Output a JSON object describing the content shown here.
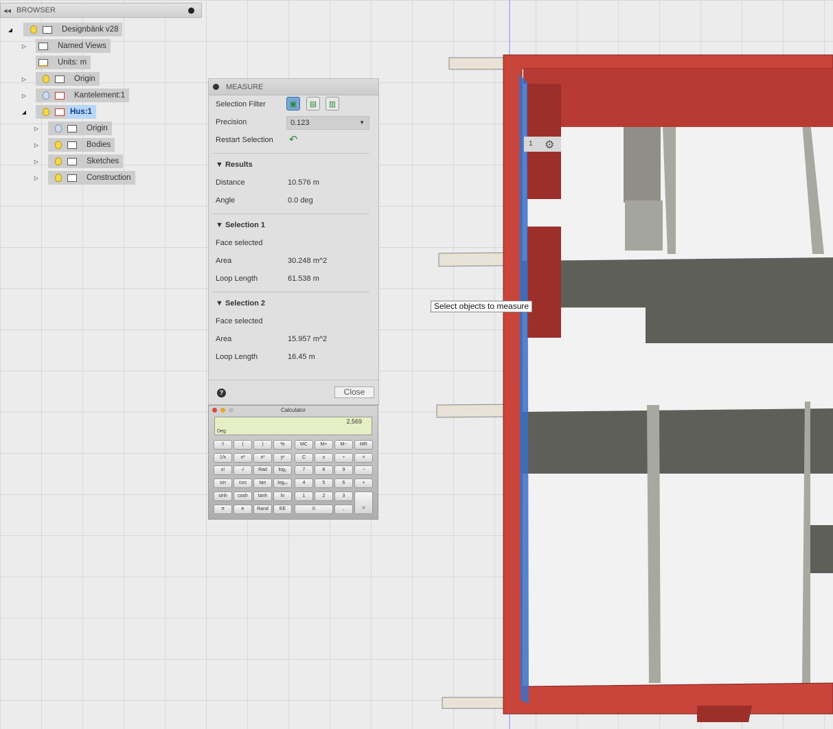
{
  "browser": {
    "title": "BROWSER",
    "nodes": [
      {
        "label": "Designbänk v28",
        "expanded": true
      },
      {
        "label": "Named Views"
      },
      {
        "label": "Units: m"
      },
      {
        "label": "Origin"
      },
      {
        "label": "Kantelement:1"
      },
      {
        "label": "Hus:1",
        "expanded": true,
        "selected": true
      },
      {
        "label": "Origin"
      },
      {
        "label": "Bodies"
      },
      {
        "label": "Sketches"
      },
      {
        "label": "Construction"
      }
    ]
  },
  "measure": {
    "title": "MEASURE",
    "selection_filter_label": "Selection Filter",
    "precision_label": "Precision",
    "precision_value": "0.123",
    "restart_label": "Restart Selection",
    "results": {
      "title": "Results",
      "distance_label": "Distance",
      "distance": "10.576 m",
      "angle_label": "Angle",
      "angle": "0.0 deg"
    },
    "selection1": {
      "title": "Selection 1",
      "status": "Face selected",
      "area_label": "Area",
      "area": "30.248 m^2",
      "loop_label": "Loop Length",
      "loop": "61.538 m"
    },
    "selection2": {
      "title": "Selection 2",
      "status": "Face selected",
      "area_label": "Area",
      "area": "15.957 m^2",
      "loop_label": "Loop Length",
      "loop": "16.45 m"
    },
    "close_label": "Close",
    "help": "?"
  },
  "calculator": {
    "title": "Calculator",
    "display": "2,569",
    "mode": "Deg",
    "keys": [
      [
        "⇧",
        "(",
        ")",
        "%",
        "MC",
        "M+",
        "M−",
        "MR"
      ],
      [
        "1/x",
        "x²",
        "x³",
        "yˣ",
        "C",
        "±",
        "÷",
        "×"
      ],
      [
        "x!",
        "√",
        "Rad",
        "log₂",
        "7",
        "8",
        "9",
        "−"
      ],
      [
        "sin",
        "cos",
        "tan",
        "log₁₀",
        "4",
        "5",
        "6",
        "+"
      ],
      [
        "sinh",
        "cosh",
        "tanh",
        "ln",
        "1",
        "2",
        "3"
      ],
      [
        "π",
        "e",
        "Rand",
        "EE",
        "0",
        ","
      ]
    ],
    "equals": "="
  },
  "viewport": {
    "tooltip": "Select objects to measure",
    "marker_number": "1",
    "colors": {
      "frame": "#c9443a",
      "wall": "#6b6b66",
      "selected_face": "#3a6fc7"
    }
  }
}
